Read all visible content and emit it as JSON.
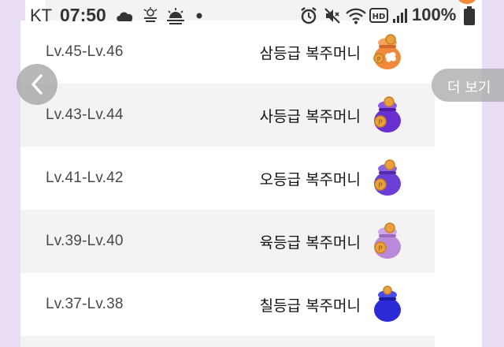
{
  "status_bar": {
    "carrier": "KT",
    "time": "07:50",
    "battery_percent": "100%",
    "icons": [
      "cloud-icon",
      "air-quality-icon",
      "weather-sunrise-icon",
      "dot-icon",
      "alarm-icon",
      "mute-icon",
      "wifi-icon",
      "hd-icon",
      "signal-icon",
      "battery-icon"
    ]
  },
  "nav": {
    "back_icon": "chevron-left-icon",
    "more_label": "더 보기"
  },
  "reward_list": {
    "rows": [
      {
        "level": "Lv.45-Lv.46",
        "reward": "삼등급 복주머니",
        "icon": "pouch-orange-icon"
      },
      {
        "level": "Lv.43-Lv.44",
        "reward": "사등급 복주머니",
        "icon": "pouch-purple-icon"
      },
      {
        "level": "Lv.41-Lv.42",
        "reward": "오등급 복주머니",
        "icon": "pouch-violet-icon"
      },
      {
        "level": "Lv.39-Lv.40",
        "reward": "육등급 복주머니",
        "icon": "pouch-lavender-icon"
      },
      {
        "level": "Lv.37-Lv.38",
        "reward": "칠등급 복주머니",
        "icon": "pouch-blue-icon"
      }
    ]
  },
  "colors": {
    "background_side": "#e9ddf6",
    "row_shade": "#f3f3f3",
    "pouch_orange": "#f08a3a",
    "pouch_purple": "#6a2fd0",
    "pouch_violet": "#6b3fd6",
    "pouch_lavender": "#b88ad8",
    "pouch_blue": "#2a2ad6",
    "coin": "#e8a13c"
  }
}
